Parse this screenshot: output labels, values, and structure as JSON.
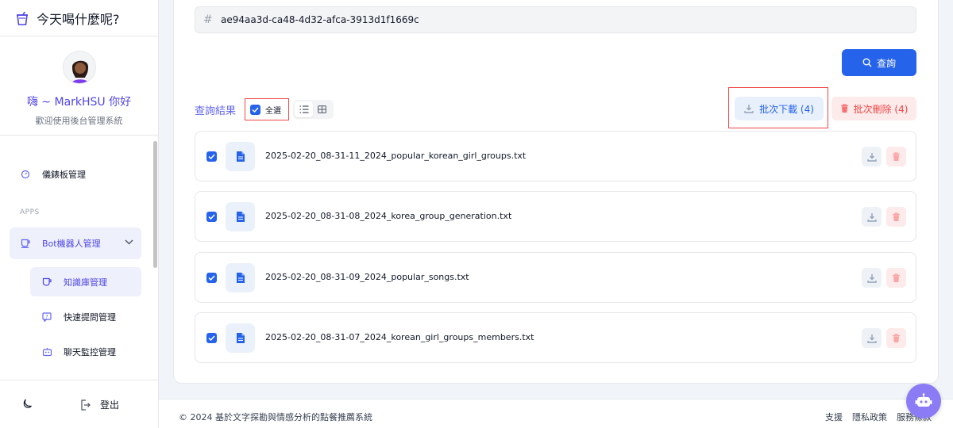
{
  "app": {
    "title": "今天喝什麼呢?"
  },
  "profile": {
    "greeting": "嗨 ~ MarkHSU 你好",
    "subtitle": "歡迎使用後台管理系統"
  },
  "nav": {
    "dashboard": "儀錶板管理",
    "section_apps": "APPS",
    "bot_manage": "Bot機器人管理",
    "knowledge": "知識庫管理",
    "quick_questions": "快速提問管理",
    "chat_monitor": "聊天監控管理"
  },
  "side_footer": {
    "logout": "登出"
  },
  "search": {
    "hash": "#",
    "value": "ae94aa3d-ca48-4d32-afca-3913d1f1669c",
    "query_button": "查詢"
  },
  "results": {
    "title": "查詢結果",
    "select_all": "全選",
    "batch_download": "批次下載 (4)",
    "batch_delete": "批次刪除 (4)",
    "files": [
      {
        "name": "2025-02-20_08-31-11_2024_popular_korean_girl_groups.txt",
        "checked": true
      },
      {
        "name": "2025-02-20_08-31-08_2024_korea_group_generation.txt",
        "checked": true
      },
      {
        "name": "2025-02-20_08-31-09_2024_popular_songs.txt",
        "checked": true
      },
      {
        "name": "2025-02-20_08-31-07_2024_korean_girl_groups_members.txt",
        "checked": true
      }
    ]
  },
  "footer": {
    "copyright": "© 2024 基於文字探勘與情感分析的點餐推薦系統",
    "links": [
      "支援",
      "隱私政策",
      "服務條款"
    ]
  },
  "colors": {
    "primary": "#2563eb",
    "accent": "#6366f1",
    "danger": "#ef4444"
  }
}
